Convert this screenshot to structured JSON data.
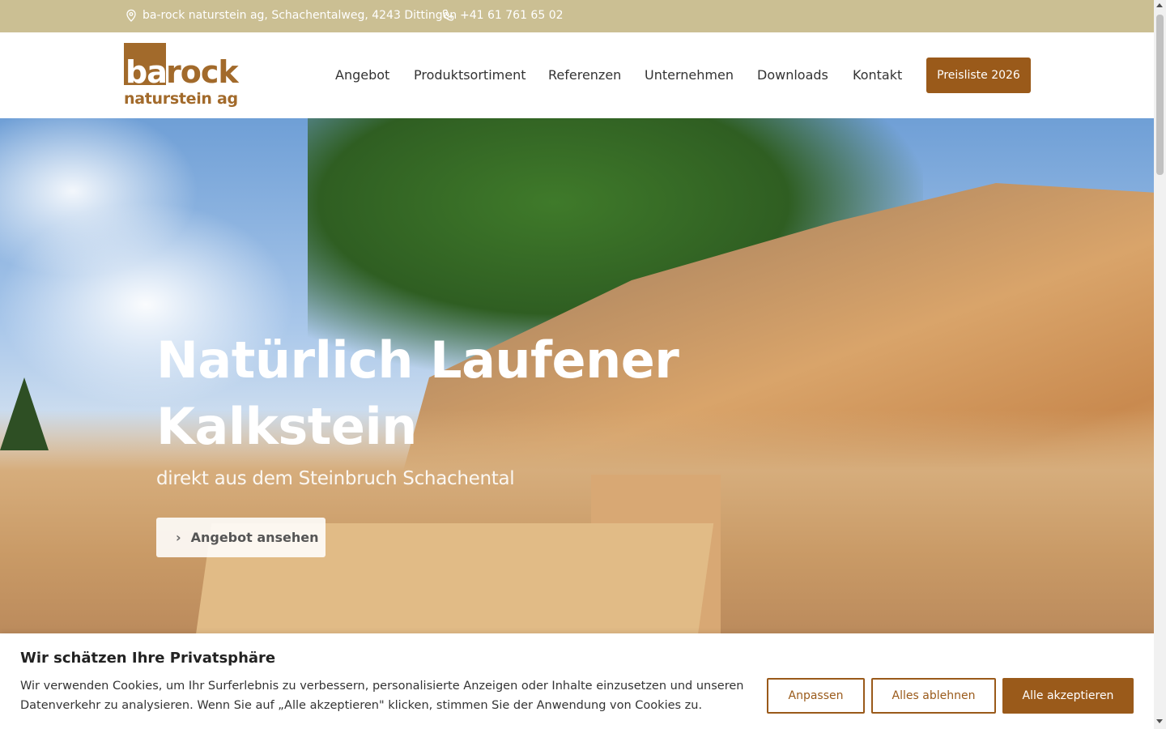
{
  "topbar": {
    "address": "ba-rock naturstein ag, Schachentalweg, 4243 Dittingen",
    "address_icon": "map-pin-icon",
    "phone": "+41 61 761 65 02",
    "phone_icon": "phone-icon",
    "background": "#cbbf93"
  },
  "logo": {
    "part1": "ba",
    "part2": "rock",
    "subline": "naturstein ag",
    "color": "#a26a2b"
  },
  "nav": {
    "items": [
      {
        "label": "Angebot"
      },
      {
        "label": "Produktsortiment"
      },
      {
        "label": "Referenzen"
      },
      {
        "label": "Unternehmen"
      },
      {
        "label": "Downloads"
      },
      {
        "label": "Kontakt"
      }
    ],
    "cta_label": "Preisliste 2026",
    "accent": "#9a5a1a"
  },
  "hero": {
    "title_line1": "Natürlich Laufener",
    "title_line2": "Kalkstein",
    "subtitle": "direkt aus dem Steinbruch Schachental",
    "button_label": "Angebot ansehen",
    "button_icon": "chevron-right-icon"
  },
  "cookie": {
    "title": "Wir schätzen Ihre Privatsphäre",
    "text": "Wir verwenden Cookies, um Ihr Surferlebnis zu verbessern, personalisierte Anzeigen oder Inhalte einzusetzen und unseren Datenverkehr zu analysieren. Wenn Sie auf „Alle akzeptieren\" klicken, stimmen Sie der Anwendung von Cookies zu.",
    "customize_label": "Anpassen",
    "reject_label": "Alles ablehnen",
    "accept_label": "Alle akzeptieren"
  }
}
